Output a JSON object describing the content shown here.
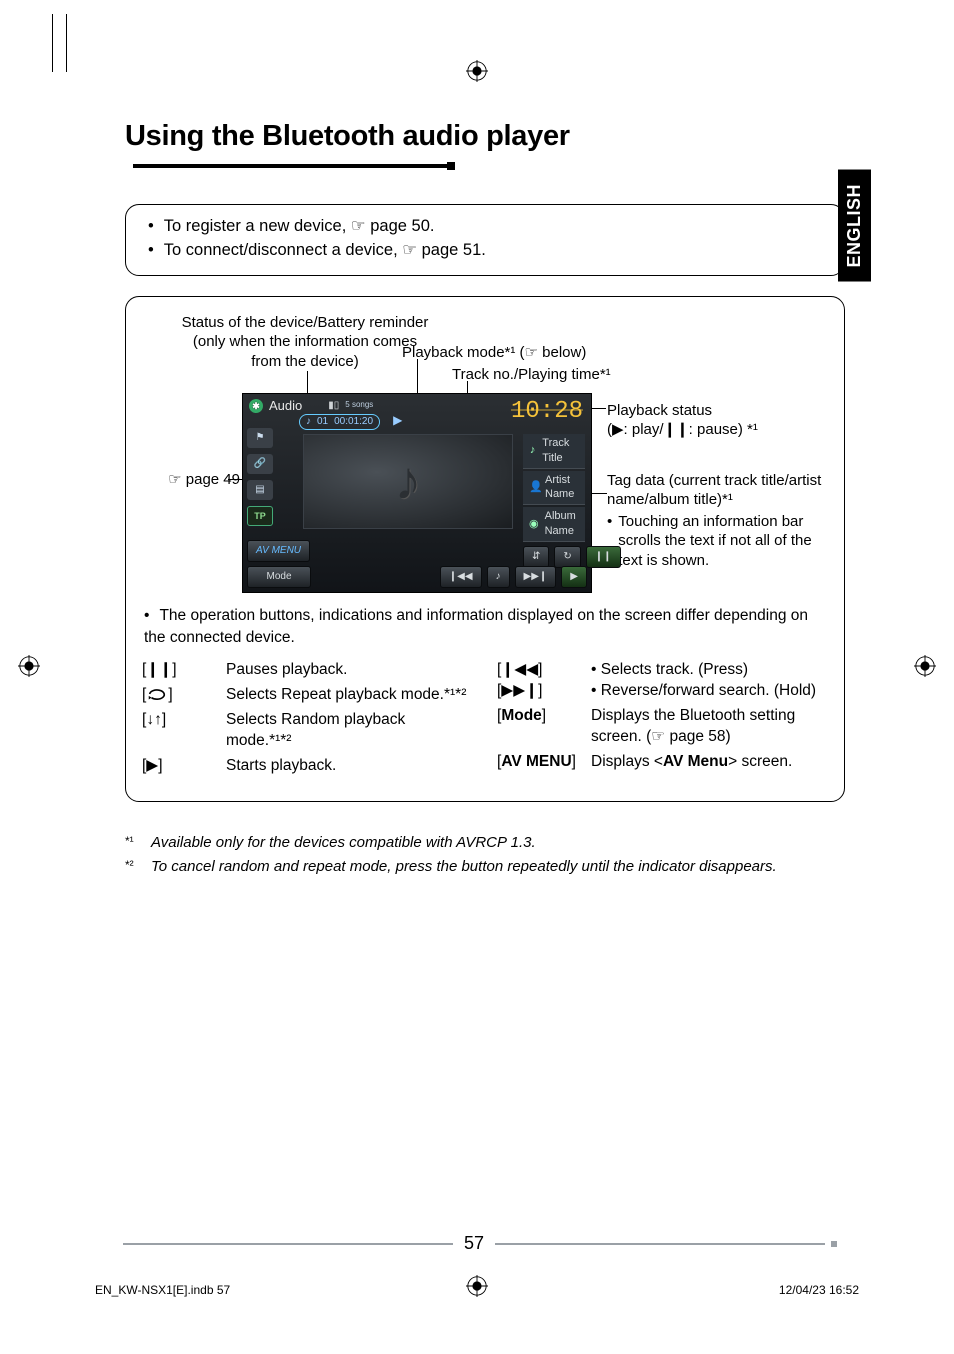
{
  "language_tab": "ENGLISH",
  "page_title": "Using the Bluetooth audio player",
  "intro": {
    "register": "To register a new device, ☞ page 50.",
    "connect": "To connect/disconnect a device, ☞ page 51."
  },
  "annotations": {
    "status": "Status of the device/Battery reminder (only when the information comes from the device)",
    "playback_mode": "Playback mode*¹ (☞ below)",
    "track_no": "Track no./Playing time*¹",
    "page49": "☞ page 49",
    "playback_status_line1": "Playback status",
    "playback_status_line2": "(▶: play/❙❙: pause) *¹",
    "tag_line1": "Tag data (current track title/artist name/album title)*¹",
    "tag_bullet": "Touching an information bar scrolls the text if not all of the text is shown."
  },
  "screenshot": {
    "source": "Audio",
    "songs_count": "5 songs",
    "track_num": "01",
    "elapsed": "00:01:20",
    "clock": "10:28",
    "track_title": "Track Title",
    "artist_name": "Artist Name",
    "album_name": "Album Name",
    "tp": "TP",
    "mode_btn": "Mode",
    "avmenu_btn": "AV MENU",
    "music_note": "♪"
  },
  "operation_note": "The operation buttons, indications and information displayed on the screen differ depending on the connected device.",
  "controls_left": [
    {
      "key": "[❙❙]",
      "desc": "Pauses playback."
    },
    {
      "key": "[repeat-icon]",
      "desc": "Selects Repeat playback mode.*¹*²"
    },
    {
      "key": "[random-icon]",
      "desc": "Selects Random playback mode.*¹*²"
    },
    {
      "key": "[▶]",
      "desc": "Starts playback."
    }
  ],
  "controls_right": [
    {
      "key": "[❙◀◀] [▶▶❙]",
      "desc_lines": [
        "Selects track. (Press)",
        "Reverse/forward search. (Hold)"
      ]
    },
    {
      "key": "[Mode]",
      "desc_plain": "Displays the Bluetooth setting screen. (☞ page 58)",
      "bold_part": "Mode"
    },
    {
      "key": "[AV MENU]",
      "desc_av": {
        "prefix": "Displays <",
        "bold": "AV Menu",
        "suffix": "> screen."
      },
      "bold_part": "AV MENU"
    }
  ],
  "footnotes": {
    "f1": "Available only for the devices compatible with AVRCP 1.3.",
    "f2": "To cancel random and repeat mode, press the button repeatedly until the indicator disappears."
  },
  "page_number": "57",
  "footer_left": "EN_KW-NSX1[E].indb   57",
  "footer_right": "12/04/23   16:52"
}
